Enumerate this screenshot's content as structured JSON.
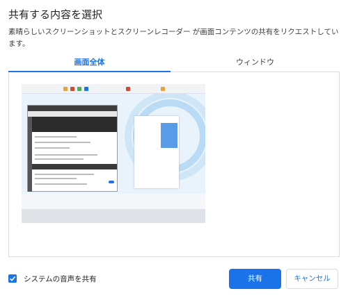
{
  "dialog": {
    "title": "共有する内容を選択",
    "subtitle": "素晴らしいスクリーンショットとスクリーンレコーダー が画面コンテンツの共有をリクエストしています。"
  },
  "tabs": [
    {
      "label": "画面全体",
      "selected": true
    },
    {
      "label": "ウィンドウ",
      "selected": false
    }
  ],
  "options": {
    "system_audio_label": "システムの音声を共有",
    "system_audio_checked": true
  },
  "buttons": {
    "share_label": "共有",
    "cancel_label": "キャンセル"
  },
  "colors": {
    "accent": "#1a73e8",
    "border": "#dadce0",
    "text": "#202124"
  }
}
